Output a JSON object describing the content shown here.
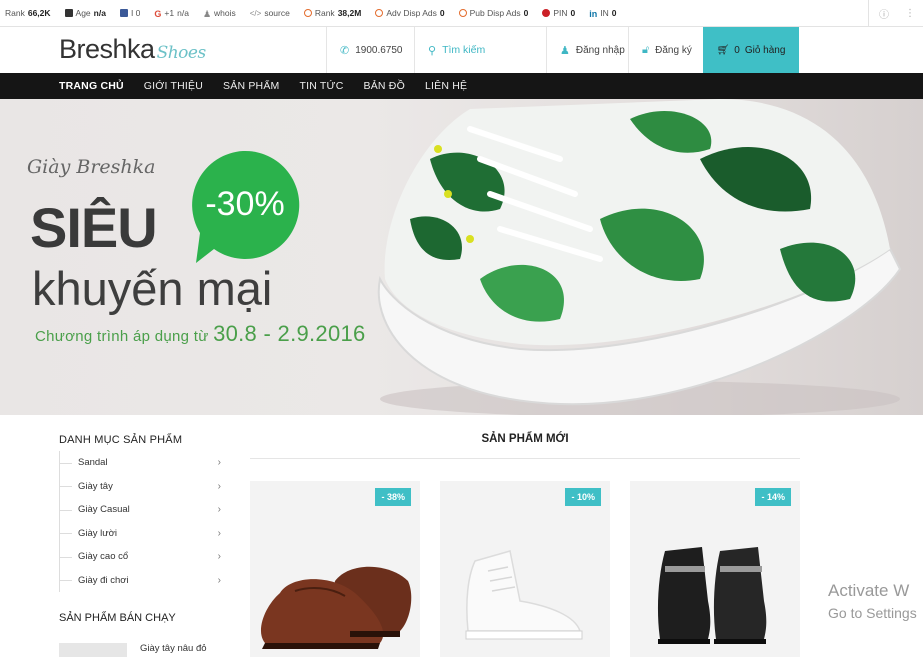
{
  "seobar": {
    "items": [
      {
        "icon": "rank-icon",
        "label": "Rank",
        "value": "66,2K"
      },
      {
        "icon": "age-icon",
        "label": "Age",
        "value": "n/a"
      },
      {
        "icon": "facebook-icon",
        "label": "",
        "value": "I 0"
      },
      {
        "icon": "google-plus-icon",
        "label": "+1",
        "value": "n/a"
      },
      {
        "icon": "whois-icon",
        "label": "whois",
        "value": ""
      },
      {
        "icon": "source-icon",
        "label": "source",
        "value": ""
      },
      {
        "icon": "rank-ring-icon",
        "label": "Rank",
        "value": "38,2M"
      },
      {
        "icon": "adv-ring-icon",
        "label": "Adv Disp Ads",
        "value": "0"
      },
      {
        "icon": "pub-ring-icon",
        "label": "Pub Disp Ads",
        "value": "0"
      },
      {
        "icon": "pinterest-icon",
        "label": "PIN",
        "value": "0"
      },
      {
        "icon": "linkedin-icon",
        "label": "IN",
        "value": "0"
      }
    ]
  },
  "header": {
    "logo_main": "Breshka",
    "logo_script": "Shoes",
    "phone": "1900.6750",
    "search_placeholder": "Tìm kiếm",
    "login": "Đăng nhập",
    "register": "Đăng ký",
    "cart_count": "0",
    "cart_label": "Giỏ hàng"
  },
  "nav": {
    "items": [
      "TRANG CHỦ",
      "GIỚI THIỆU",
      "SẢN PHẨM",
      "TIN TỨC",
      "BẢN ĐỒ",
      "LIÊN HỆ"
    ]
  },
  "banner": {
    "script": "Giày Breshka",
    "headline": "SIÊU",
    "subheadline": "khuyến mại",
    "badge": "-30%",
    "program_prefix": "Chương trình áp dụng từ",
    "program_dates": "30.8 - 2.9.2016"
  },
  "sidebar": {
    "title": "DANH MỤC SẢN PHẨM",
    "items": [
      "Sandal",
      "Giày tây",
      "Giày Casual",
      "Giày lười",
      "Giày cao cổ",
      "Giày đi chơi"
    ],
    "best_title": "SẢN PHẨM BÁN CHẠY",
    "best_item": "Giày tây nâu đỏ"
  },
  "products": {
    "title": "SẢN PHẨM MỚI",
    "items": [
      {
        "discount": "- 38%",
        "kind": "brown-oxford"
      },
      {
        "discount": "- 10%",
        "kind": "white-sneaker"
      },
      {
        "discount": "- 14%",
        "kind": "black-hightop"
      }
    ]
  },
  "watermark": {
    "line1": "Activate W",
    "line2": "Go to Settings"
  },
  "colors": {
    "accent": "#3fbfc6",
    "nav_bg": "#151515",
    "promo_green": "#2bb24c"
  }
}
